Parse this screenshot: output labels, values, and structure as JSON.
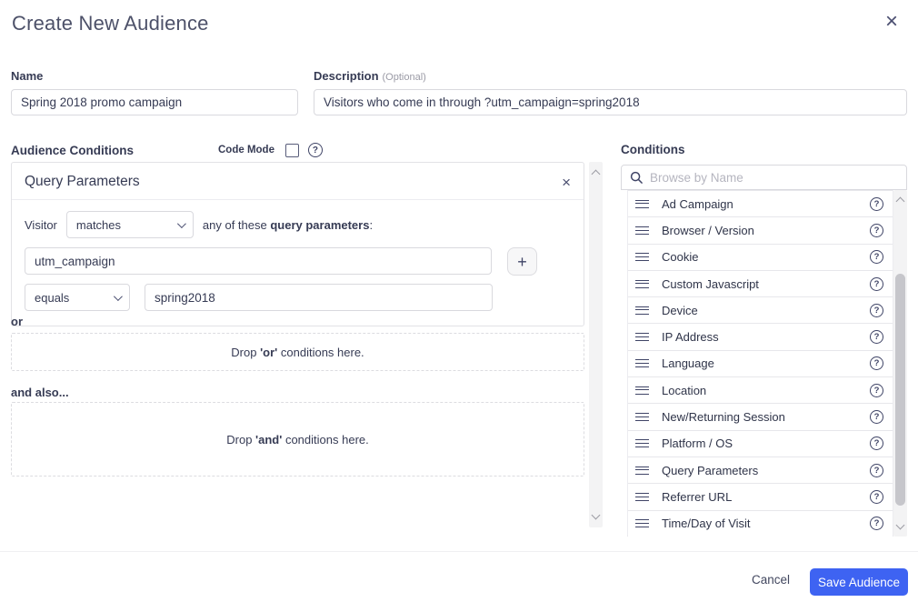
{
  "modal": {
    "title": "Create New Audience",
    "close_icon": "×"
  },
  "form": {
    "name": {
      "label": "Name",
      "value": "Spring 2018 promo campaign"
    },
    "description": {
      "label": "Description",
      "optional_label": "(Optional)",
      "value": "Visitors who come in through ?utm_campaign=spring2018"
    }
  },
  "builder": {
    "section_label": "Audience Conditions",
    "code_mode_label": "Code Mode",
    "help_icon": "?",
    "card": {
      "title": "Query Parameters",
      "close_icon": "×",
      "subject_label": "Visitor",
      "match_select_value": "matches",
      "clause_prefix": "any of these ",
      "clause_bold": "query parameters",
      "clause_suffix": ":",
      "param_value": "utm_campaign",
      "add_button_label": "+",
      "operator_select_value": "equals",
      "value_input": "spring2018"
    },
    "or_label": "or",
    "or_drop": {
      "prefix": "Drop ",
      "bold": "'or'",
      "suffix": " conditions here."
    },
    "and_label": "and also...",
    "and_drop": {
      "prefix": "Drop ",
      "bold": "'and'",
      "suffix": " conditions here."
    }
  },
  "conditions_panel": {
    "title": "Conditions",
    "search_placeholder": "Browse by Name",
    "help_icon": "?",
    "items": [
      "Ad Campaign",
      "Browser / Version",
      "Cookie",
      "Custom Javascript",
      "Device",
      "IP Address",
      "Language",
      "Location",
      "New/Returning Session",
      "Platform / OS",
      "Query Parameters",
      "Referrer URL",
      "Time/Day of Visit"
    ]
  },
  "footer": {
    "cancel_label": "Cancel",
    "save_label": "Save Audience"
  },
  "colors": {
    "accent_blue": "#3e63f2",
    "text_navy": "#363b54"
  }
}
